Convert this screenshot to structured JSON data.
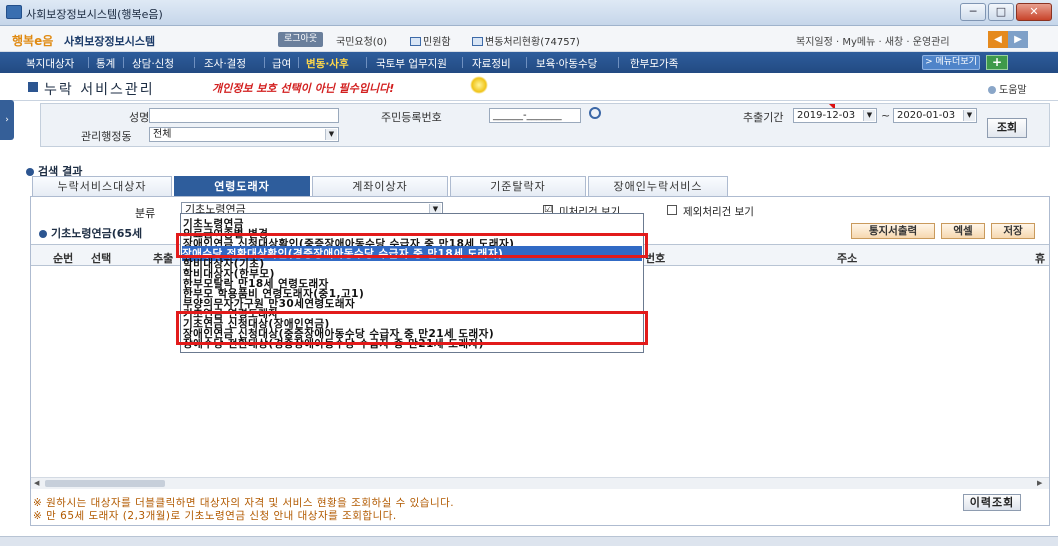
{
  "window": {
    "title": "사회보장정보시스템(행복e음)",
    "buttons": [
      "─",
      "□",
      "✕"
    ]
  },
  "header": {
    "logo_mark": "행복e음",
    "logo_text": "사회보장정보시스템",
    "logout": "로그아웃",
    "civil_requests": "국민요청(0)",
    "complaints": "민원함",
    "changes": "변동처리현황(74757)",
    "right_links": "복지일정 · My메뉴 · 새창 · 운영관리"
  },
  "menu": {
    "items": [
      "복지대상자",
      "통계",
      "상담·신청",
      "조사·결정",
      "급여",
      "변동·사후",
      "국토부 업무지원",
      "자료정비",
      "보육·아동수당",
      "한부모가족"
    ],
    "active": "변동·사후",
    "more": "> 메뉴더보기",
    "plus": "+"
  },
  "page": {
    "title": "누락 서비스관리",
    "handwritten": "개인정보 보호 선택이 아닌 필수입니다!",
    "help": "도움말"
  },
  "search": {
    "name_label": "성명",
    "name_value": "",
    "rrn_label": "주민등록번호",
    "rrn_value": "______-_______",
    "period_label": "추출기간",
    "date_from": "2019-12-03",
    "tilde": "~",
    "date_to": "2020-01-03",
    "district_label": "관리행정동",
    "district_value": "전체",
    "search_btn": "조회"
  },
  "results": {
    "label": "검색 결과",
    "tabs": [
      "누락서비스대상자",
      "연령도래자",
      "계좌이상자",
      "기준탈락자",
      "장애인누락서비스"
    ],
    "active_tab": "연령도래자",
    "category_label": "분류",
    "category_value": "기초노령연금",
    "chk1_label": "미처리건 보기",
    "chk1_checked": "☑",
    "chk2_label": "제외처리건 보기",
    "sub_label": "기초노령연금(65세",
    "buttons": {
      "notice": "통지서출력",
      "excel": "엑셀",
      "save": "저장"
    },
    "columns": {
      "seq": "순번",
      "select": "선택",
      "extract": "추출",
      "rrn": "번호",
      "address": "주소",
      "last": "휴"
    },
    "note1": "※ 원하시는 대상자를 더블클릭하면 대상자의 자격 및 서비스 현황을 조회하실 수 있습니다.",
    "note2": "※ 만 65세 도래자 (2,3개월)로 기초노령연금 신청 안내 대상자를 조회합니다.",
    "history_btn": "이력조회"
  },
  "dropdown": {
    "options": [
      "기초노령연금",
      "의료급여종별 변경",
      "장애인연금 신청대상확인(중증장애아동수당 수급자 중 만18세 도래자)",
      "장애수당 전환대상확인(경증장애아동수당 수급자 중 만18세 도래자)",
      "학비대상자(기초)",
      "학비대상자(한부모)",
      "한부모탈락 만18세 연령도래자",
      "한부모 학용품비 연령도래자(중1,고1)",
      "부양의무자가구원 만30세연령도래자",
      "기초연금 연령도래자",
      "기초연금 신청대상(장애인연금)",
      "장애인연금 신청대상(중증장애아동수당 수급자 중 만21세 도래자)",
      "장애수당 전환대상(경증장애아동수당 수급자 중 만21세 도래자)"
    ],
    "selected": 3
  }
}
